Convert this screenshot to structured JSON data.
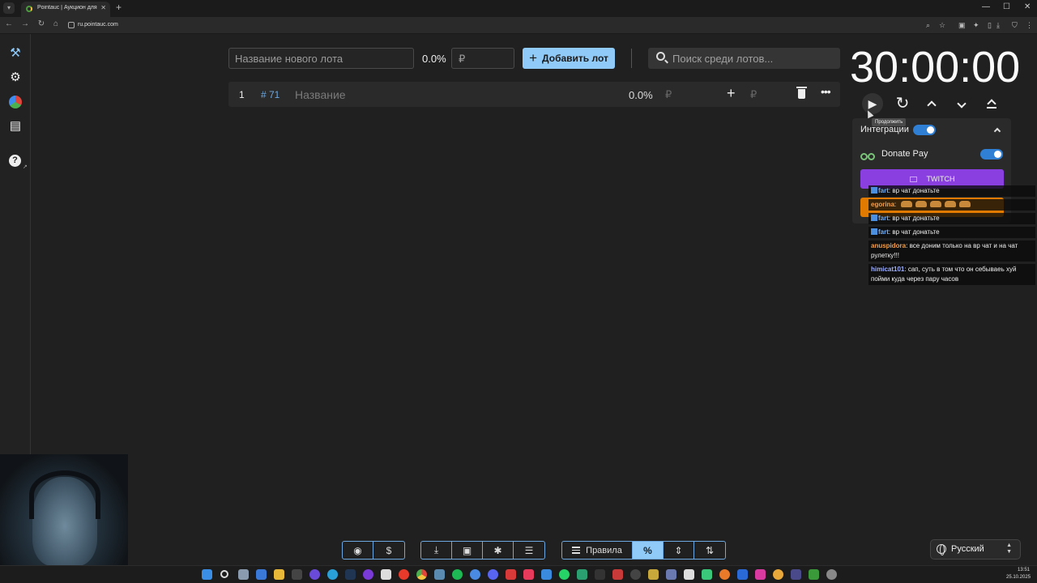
{
  "browser": {
    "tab_title": "Pointauc | Аукцион для стримеров",
    "url": "ru.pointauc.com"
  },
  "new_lot": {
    "name_placeholder": "Название нового лота",
    "percent": "0.0%",
    "amount_placeholder": "₽",
    "add_button_label": "Добавить лот"
  },
  "search": {
    "placeholder": "Поиск среди лотов..."
  },
  "lots": [
    {
      "index": "1",
      "id": "# 71",
      "name": "Название",
      "percent": "0.0%",
      "currency": "₽",
      "add_currency": "₽"
    }
  ],
  "timer": {
    "value": "30:00:00",
    "play_tooltip": "Продолжить"
  },
  "integrations": {
    "title": "Интеграции",
    "enabled": true,
    "donatepay_label": "Donate Pay",
    "donatepay_enabled": true,
    "twitch_label": "TWITCH"
  },
  "chat": [
    {
      "user": "fart",
      "text": "вр чат донатьте",
      "color": "blue",
      "badge": true
    },
    {
      "user": "egorina",
      "text": "",
      "color": "orange",
      "badge": false,
      "emotes": 5
    },
    {
      "user": "fart",
      "text": "вр чат донатьте",
      "color": "blue",
      "badge": true
    },
    {
      "user": "fart",
      "text": "вр чат донатьте",
      "color": "blue",
      "badge": true
    },
    {
      "user": "anuspidora",
      "text": "все доним только на вр чат и на чат рулетку!!!",
      "color": "orange",
      "badge": false
    },
    {
      "user": "himicat101",
      "text": "сап, суть в том что он себываеь хуй пойми куда через пару часов",
      "color": "lav",
      "badge": false
    }
  ],
  "bottom_bar": {
    "rules_label": "Правила",
    "percent_label": "%"
  },
  "language": {
    "current": "Русский"
  },
  "taskbar": {
    "time": "13:51",
    "date": "25.10.2025"
  },
  "colors": {
    "accent": "#90caf9",
    "twitch": "#8a3fe0",
    "toggle": "#2f7fd4",
    "background": "#202020"
  }
}
